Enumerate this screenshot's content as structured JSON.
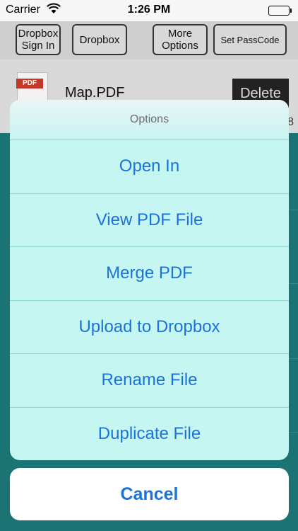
{
  "status_bar": {
    "carrier": "Carrier",
    "time": "1:26 PM",
    "wifi_icon": "wifi-icon",
    "battery_icon": "battery-icon"
  },
  "toolbar": {
    "dropbox_sign_in": "Dropbox\nSign In",
    "dropbox": "Dropbox",
    "more_options": "More\nOptions",
    "set_passcode": "Set PassCode"
  },
  "file_row": {
    "icon_label": "PDF",
    "name": "Map.PDF",
    "delete_label": "Delete",
    "meta": "8"
  },
  "action_sheet": {
    "title": "Options",
    "items": [
      "Open In",
      "View PDF File",
      "Merge PDF",
      "Upload to Dropbox",
      "Rename File",
      "Duplicate File"
    ],
    "cancel_label": "Cancel"
  },
  "colors": {
    "accent": "#1a73d9",
    "sheet_bg": "#c6f6f2",
    "list_bg": "#1c7373"
  }
}
